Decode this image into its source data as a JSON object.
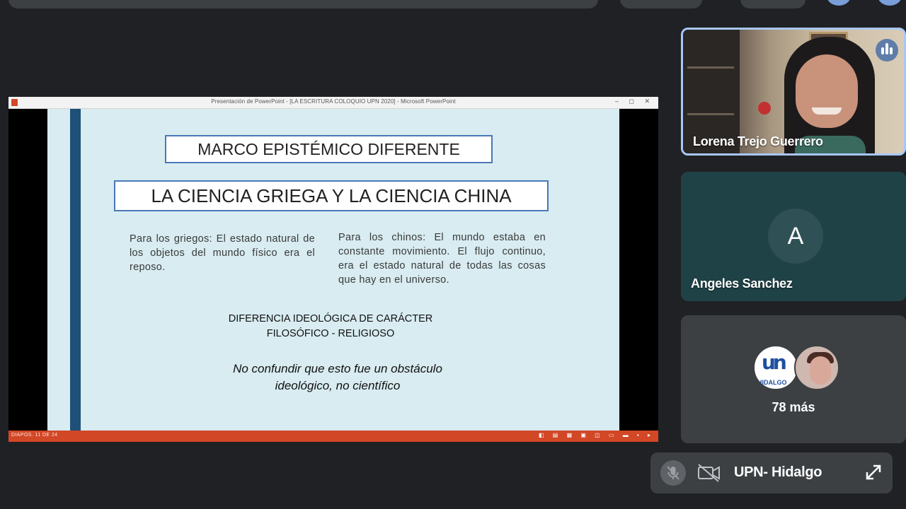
{
  "presentation": {
    "window_title": "Presentación de PowerPoint - [LA ESCRITURA COLOQUIO UPN 2020] - Microsoft PowerPoint",
    "window_controls": "– ◻ ✕",
    "status_left": "DIAPOS. 11 DE 24",
    "status_right_icons": "◧ ▤ ▦ ▣ ◫ ▭ ▬ ▪ ▸",
    "slide": {
      "heading1": "MARCO EPISTÉMICO DIFERENTE",
      "heading2": "LA CIENCIA GRIEGA Y LA CIENCIA CHINA",
      "greeks": "Para los griegos: El estado natural de los objetos del mundo físico era el reposo.",
      "chinese": "Para los chinos: El mundo estaba en constante movimiento. El flujo continuo, era el estado natural de todas las cosas que hay en el universo.",
      "difference_line1": "DIFERENCIA IDEOLÓGICA DE CARÁCTER",
      "difference_line2": "FILOSÓFICO - RELIGIOSO",
      "note_line1": "No confundir que esto fue un obstáculo",
      "note_line2": "ideológico, no científico"
    }
  },
  "participants": [
    {
      "name": "Lorena Trejo Guerrero",
      "video": true,
      "speaking": true
    },
    {
      "name": "Angeles Sanchez",
      "initial": "A",
      "video": false
    },
    {
      "more_label": "78 más",
      "avatar_text": "un",
      "avatar_subtext": "HIDALGO"
    }
  ],
  "self_view": {
    "name": "UPN- Hidalgo",
    "mic_muted": true,
    "camera_off": true
  },
  "colors": {
    "background": "#202124",
    "tile": "#3c4043",
    "accent": "#a8c7fa",
    "ppt_red": "#d24726",
    "slide_bg": "#d8ecf1"
  }
}
